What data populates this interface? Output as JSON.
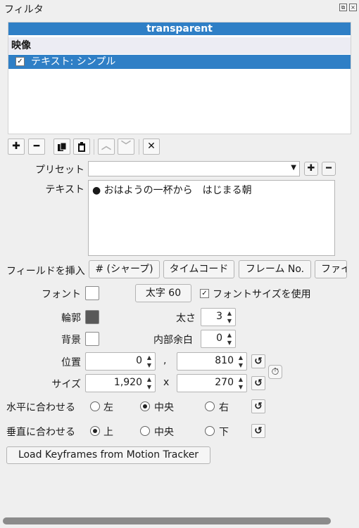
{
  "window": {
    "title": "フィルタ"
  },
  "filter_panel": {
    "header": "transparent",
    "group": "映像",
    "items": [
      {
        "label": "テキスト: シンプル",
        "checked": true
      }
    ]
  },
  "toolbar": {
    "buttons": [
      "add-icon",
      "remove-icon",
      "copy-icon",
      "paste-icon",
      "move-up-icon",
      "move-down-icon",
      "close-icon"
    ]
  },
  "preset": {
    "label": "プリセット",
    "value": ""
  },
  "text": {
    "label": "テキスト",
    "value": "● おはようの一杯から　はじまる朝"
  },
  "insert_field": {
    "label": "フィールドを挿入",
    "buttons": [
      "# (シャープ)",
      "タイムコード",
      "フレーム No.",
      "ファイ"
    ]
  },
  "font": {
    "label": "フォント",
    "bold_button": "太字 60",
    "use_size_label": "フォントサイズを使用",
    "use_size_checked": true
  },
  "outline": {
    "label": "輪郭",
    "color": "#595959",
    "thickness_label": "太さ",
    "thickness": "3"
  },
  "background": {
    "label": "背景",
    "padding_label": "内部余白",
    "padding": "0"
  },
  "position": {
    "label": "位置",
    "x": "0",
    "separator": ",",
    "y": "810"
  },
  "size": {
    "label": "サイズ",
    "width": "1,920",
    "separator": "x",
    "height": "270"
  },
  "h_align": {
    "label": "水平に合わせる",
    "options": [
      "左",
      "中央",
      "右"
    ],
    "selected": "中央"
  },
  "v_align": {
    "label": "垂直に合わせる",
    "options": [
      "上",
      "中央",
      "下"
    ],
    "selected": "上"
  },
  "load_keyframes": "Load Keyframes from Motion Tracker",
  "colors": {
    "accent": "#2f7fc6",
    "background": "#efefef"
  }
}
